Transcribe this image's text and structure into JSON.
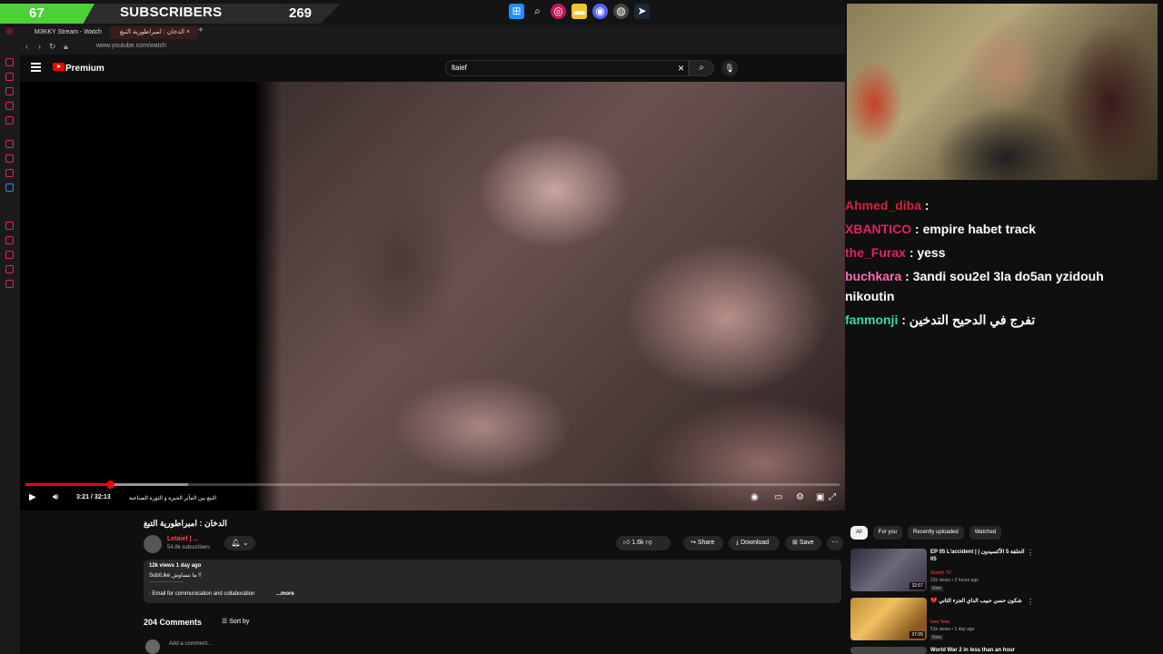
{
  "overlay": {
    "followers_count": "67",
    "subscribers_label": "SUBSCRIBERS",
    "subscribers_count": "269"
  },
  "browser": {
    "tabs": [
      {
        "label": "M3KKY Stream - Watch Li"
      },
      {
        "label": "الدخان : امبراطورية التبغ ×"
      }
    ],
    "url": "www.youtube.com/watch"
  },
  "youtube": {
    "brand": "Premium",
    "search_value": "ltaief"
  },
  "player": {
    "time": "3:21 / 32:13",
    "progress_fraction": 0.104,
    "chapter": "التبغ بين المآثر الخيرة و الثورة الصناعية"
  },
  "video": {
    "title": "الدخان : امبراطورية التبغ",
    "channel_name": "Letaief | ...",
    "channel_subs": "54.8k subscribers",
    "likes": "1.6k",
    "share_label": "Share",
    "download_label": "Download",
    "save_label": "Save",
    "views_date": "12k views  1 day ago",
    "desc_line1": "Sub/Like ما تنساوش !!",
    "desc_line2": "-------------------",
    "desc_line3": ": Email for communication and collaboration",
    "desc_more": "...more"
  },
  "comments": {
    "count_label": "204 Comments",
    "sort_label": "Sort by",
    "add_placeholder": "Add a comment..."
  },
  "chat": {
    "messages": [
      {
        "user": "Ahmed_diba",
        "text": "",
        "color": "#d2213a"
      },
      {
        "user": "XBANTICO",
        "text": ": empire habet track",
        "color": "#e0245e"
      },
      {
        "user": "the_Furax",
        "text": ": yess",
        "color": "#e0245e"
      },
      {
        "user": "buchkara",
        "text": ": 3andi sou2el 3la do5an yzidouh",
        "color": "#ff69b4"
      },
      {
        "user": "",
        "text": "nikoutin",
        "color": "#ffffff"
      },
      {
        "user": "fanmonji",
        "text": ": تفرج في الدحيح التدخين",
        "color": "#3ad7b0"
      }
    ]
  },
  "recommendations": {
    "chips": [
      "All",
      "For you",
      "Recently uploaded",
      "Watched"
    ],
    "items": [
      {
        "title": "EP 05 L'accident | الحلقة 5 الأكسيدون | 05",
        "channel": "Sketch TV",
        "meta": "31k views • 2 hours ago",
        "duration": "32:07",
        "tag": "New"
      },
      {
        "title": "💔 شكون حسن حبيب الداي الجزء الثاني",
        "channel": "Issa Tene",
        "meta": "51k views • 1 day ago",
        "duration": "37:05",
        "tag": "New"
      },
      {
        "title": "World War 2 in less than an hour",
        "channel": "",
        "meta": "",
        "duration": "",
        "tag": ""
      }
    ]
  },
  "colors": {
    "accent_red": "#ff0000",
    "subscriber_green": "#4cd137"
  }
}
